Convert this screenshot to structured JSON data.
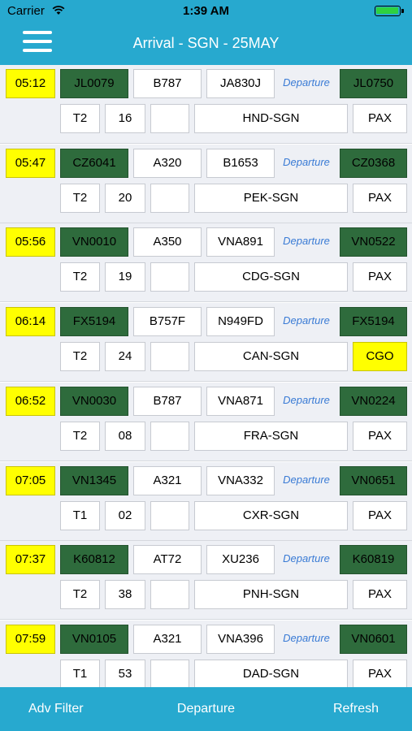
{
  "status_bar": {
    "carrier": "Carrier",
    "time": "1:39 AM"
  },
  "nav": {
    "title": "Arrival - SGN - 25MAY"
  },
  "rows": [
    {
      "time": "05:12",
      "flight": "JL0079",
      "aircraft": "B787",
      "reg": "JA830J",
      "link": "Departure",
      "dep_flight": "JL0750",
      "terminal": "T2",
      "gate": "16",
      "blank": "",
      "route": "HND-SGN",
      "type": "PAX",
      "type_color": "white"
    },
    {
      "time": "05:47",
      "flight": "CZ6041",
      "aircraft": "A320",
      "reg": "B1653",
      "link": "Departure",
      "dep_flight": "CZ0368",
      "terminal": "T2",
      "gate": "20",
      "blank": "",
      "route": "PEK-SGN",
      "type": "PAX",
      "type_color": "white"
    },
    {
      "time": "05:56",
      "flight": "VN0010",
      "aircraft": "A350",
      "reg": "VNA891",
      "link": "Departure",
      "dep_flight": "VN0522",
      "terminal": "T2",
      "gate": "19",
      "blank": "",
      "route": "CDG-SGN",
      "type": "PAX",
      "type_color": "white"
    },
    {
      "time": "06:14",
      "flight": "FX5194",
      "aircraft": "B757F",
      "reg": "N949FD",
      "link": "Departure",
      "dep_flight": "FX5194",
      "terminal": "T2",
      "gate": "24",
      "blank": "",
      "route": "CAN-SGN",
      "type": "CGO",
      "type_color": "yellow"
    },
    {
      "time": "06:52",
      "flight": "VN0030",
      "aircraft": "B787",
      "reg": "VNA871",
      "link": "Departure",
      "dep_flight": "VN0224",
      "terminal": "T2",
      "gate": "08",
      "blank": "",
      "route": "FRA-SGN",
      "type": "PAX",
      "type_color": "white"
    },
    {
      "time": "07:05",
      "flight": "VN1345",
      "aircraft": "A321",
      "reg": "VNA332",
      "link": "Departure",
      "dep_flight": "VN0651",
      "terminal": "T1",
      "gate": "02",
      "blank": "",
      "route": "CXR-SGN",
      "type": "PAX",
      "type_color": "white"
    },
    {
      "time": "07:37",
      "flight": "K60812",
      "aircraft": "AT72",
      "reg": "XU236",
      "link": "Departure",
      "dep_flight": "K60819",
      "terminal": "T2",
      "gate": "38",
      "blank": "",
      "route": "PNH-SGN",
      "type": "PAX",
      "type_color": "white"
    },
    {
      "time": "07:59",
      "flight": "VN0105",
      "aircraft": "A321",
      "reg": "VNA396",
      "link": "Departure",
      "dep_flight": "VN0601",
      "terminal": "T1",
      "gate": "53",
      "blank": "",
      "route": "DAD-SGN",
      "type": "PAX",
      "type_color": "white"
    }
  ],
  "tab_bar": {
    "adv_filter": "Adv Filter",
    "departure": "Departure",
    "refresh": "Refresh"
  },
  "colors": {
    "accent": "#27a9cf",
    "time_bg": "#ffff00",
    "flight_bg": "#2e6b3c",
    "link": "#3a7bd5"
  }
}
